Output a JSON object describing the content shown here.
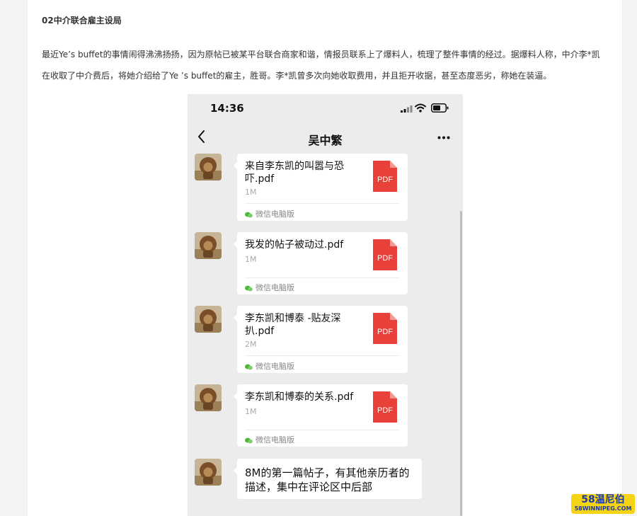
{
  "article": {
    "heading": "02中介联合雇主设局",
    "paragraph_lines": [
      "最近Ye’s buffet的事情闹得沸沸扬扬，因为原帖已被某平台联合商家和谐，情报员联系上了爆料人，梳理了整件事情的经过。据爆料人称，中介李*凯",
      "在收取了中介费后，将她介绍给了Ye ’s buffet的雇主，胜哥。李*凯曾多次向她收取费用，并且拒开收据，甚至态度恶劣，称她在装逼。"
    ]
  },
  "phone": {
    "time": "14:36",
    "chat_title": "吴中繁",
    "messages": [
      {
        "name": "来自李东凯的叫嚣与恐吓.pdf",
        "size": "1M",
        "source": "微信电脑版"
      },
      {
        "name": "我发的帖子被动过.pdf",
        "size": "1M",
        "source": "微信电脑版"
      },
      {
        "name": "李东凯和博泰 -贴友深扒.pdf",
        "size": "2M",
        "source": "微信电脑版"
      },
      {
        "name": "李东凯和博泰的关系.pdf",
        "size": "1M",
        "source": "微信电脑版"
      }
    ],
    "text_message": "8M的第一篇帖子，有其他亲历者的描述，集中在评论区中后部",
    "pdf_label": "PDF"
  },
  "watermark": {
    "top": "58温尼伯",
    "bottom": "58WINNIPEG.COM"
  },
  "colors": {
    "pdf_red": "#e8413a",
    "wechat_green": "#4fb43c",
    "watermark_yellow": "#f5d315",
    "watermark_blue": "#1a3aa8"
  }
}
